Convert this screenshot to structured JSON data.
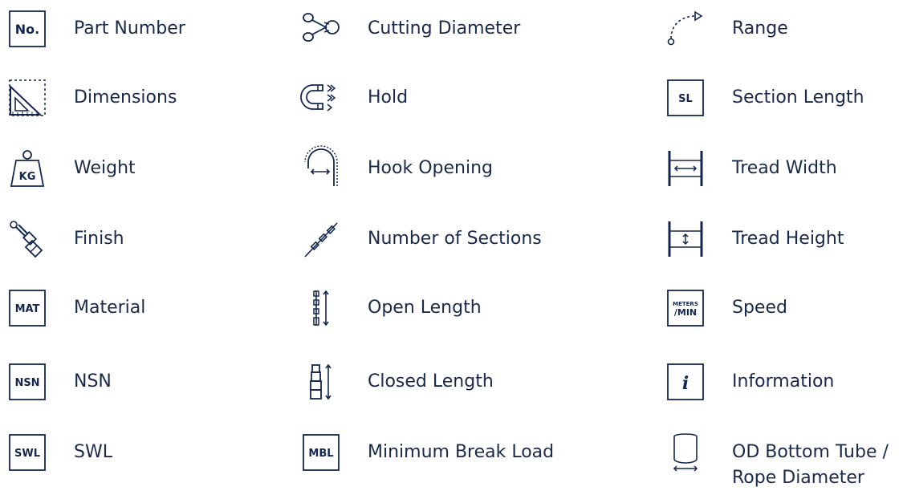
{
  "columns": [
    {
      "items": [
        {
          "icon": "part-number-icon",
          "icon_text": "No.",
          "label": "Part Number"
        },
        {
          "icon": "dimensions-icon",
          "label": "Dimensions"
        },
        {
          "icon": "weight-icon",
          "icon_text": "KG",
          "label": "Weight"
        },
        {
          "icon": "paintbrush-icon",
          "label": "Finish"
        },
        {
          "icon": "material-icon",
          "icon_text": "MAT",
          "label": "Material"
        },
        {
          "icon": "nsn-icon",
          "icon_text": "NSN",
          "label": "NSN"
        },
        {
          "icon": "swl-icon",
          "icon_text": "SWL",
          "label": "SWL"
        }
      ]
    },
    {
      "items": [
        {
          "icon": "scissors-icon",
          "label": "Cutting Diameter"
        },
        {
          "icon": "magnet-icon",
          "label": "Hold"
        },
        {
          "icon": "hook-icon",
          "label": "Hook Opening"
        },
        {
          "icon": "pole-sections-icon",
          "label": "Number of Sections"
        },
        {
          "icon": "open-length-icon",
          "label": "Open Length"
        },
        {
          "icon": "closed-length-icon",
          "label": "Closed Length"
        },
        {
          "icon": "mbl-icon",
          "icon_text": "MBL",
          "label": "Minimum Break Load"
        }
      ]
    },
    {
      "items": [
        {
          "icon": "range-icon",
          "label": "Range"
        },
        {
          "icon": "section-length-icon",
          "icon_text": "SL",
          "label": "Section Length"
        },
        {
          "icon": "tread-width-icon",
          "label": "Tread Width"
        },
        {
          "icon": "tread-height-icon",
          "label": "Tread Height"
        },
        {
          "icon": "speed-icon",
          "icon_text_top": "METERS",
          "icon_text_bottom": "/MIN",
          "label": "Speed"
        },
        {
          "icon": "information-icon",
          "icon_text": "i",
          "label": "Information"
        },
        {
          "icon": "od-bottom-tube-icon",
          "label": "OD Bottom Tube /\nRope Diameter"
        }
      ]
    }
  ]
}
